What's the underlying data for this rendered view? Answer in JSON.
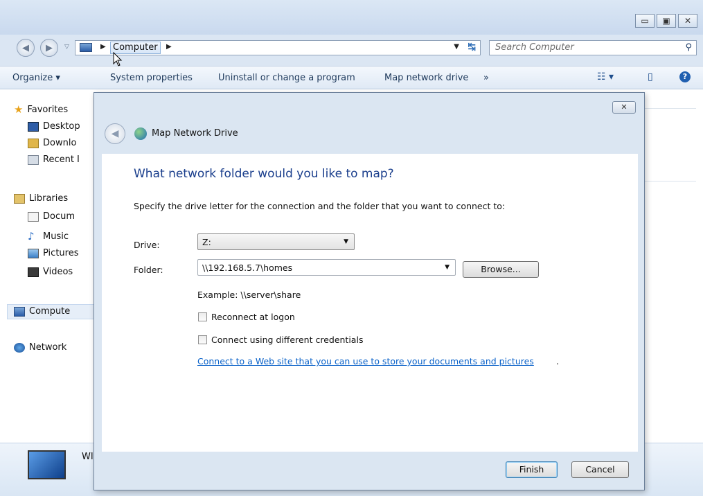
{
  "explorer": {
    "address": {
      "crumb": "Computer"
    },
    "search": {
      "placeholder": "Search Computer"
    },
    "toolbar": {
      "organize": "Organize ▾",
      "system_properties": "System properties",
      "uninstall": "Uninstall or change a program",
      "map_drive": "Map network drive",
      "more": "»"
    },
    "sidebar": {
      "favorites": "Favorites",
      "desktop": "Desktop",
      "downloads": "Downlo",
      "recent": "Recent I",
      "libraries": "Libraries",
      "documents": "Docum",
      "music": "Music",
      "pictures": "Pictures",
      "videos": "Videos",
      "computer": "Compute",
      "network": "Network"
    },
    "details": {
      "name": "WI"
    }
  },
  "dialog": {
    "title": "Map Network Drive",
    "heading": "What network folder would you like to map?",
    "description": "Specify the drive letter for the connection and the folder that you want to connect to:",
    "drive_label": "Drive:",
    "drive_value": "Z:",
    "folder_label": "Folder:",
    "folder_value": "\\\\192.168.5.7\\homes",
    "browse": "Browse...",
    "example": "Example: \\\\server\\share",
    "reconnect": "Reconnect at logon",
    "different_credentials": "Connect using different credentials",
    "web_link": "Connect to a Web site that you can use to store your documents and pictures",
    "link_suffix": ".",
    "finish": "Finish",
    "cancel": "Cancel"
  }
}
